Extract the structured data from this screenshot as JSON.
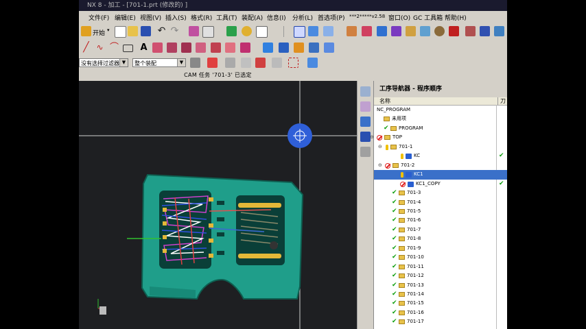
{
  "title_bar": "NX 8 - 加工 - [701-1.prt  (修改的) ]",
  "menu": [
    "文件(F)",
    "编辑(E)",
    "视图(V)",
    "插入(S)",
    "格式(R)",
    "工具(T)",
    "装配(A)",
    "信息(I)",
    "分析(L)",
    "首选项(P)",
    "***2*****v2.58",
    "窗口(O)",
    "GC 工具箱",
    "帮助(H)"
  ],
  "toolbar1": {
    "start_label": "开始"
  },
  "filter_bar": {
    "type_filter": "没有选择过滤器",
    "scope": "整个装配"
  },
  "status_text": "CAM 任务 '701-3' 已选定",
  "navigator": {
    "title": "工序导航器 - 程序顺序",
    "col_name": "名称",
    "col_tool": "刀",
    "rows": [
      {
        "label": "NC_PROGRAM"
      },
      {
        "label": "未用项"
      },
      {
        "label": "PROGRAM"
      },
      {
        "label": "TOP"
      },
      {
        "label": "701-1"
      },
      {
        "label": "KC"
      },
      {
        "label": "701-2"
      },
      {
        "label": "KC1"
      },
      {
        "label": "KC1_COPY"
      },
      {
        "label": "701-3"
      },
      {
        "label": "701-4"
      },
      {
        "label": "701-5"
      },
      {
        "label": "701-6"
      },
      {
        "label": "701-7"
      },
      {
        "label": "701-8"
      },
      {
        "label": "701-9"
      },
      {
        "label": "701-10"
      },
      {
        "label": "701-11"
      },
      {
        "label": "701-12"
      },
      {
        "label": "701-13"
      },
      {
        "label": "701-14"
      },
      {
        "label": "701-15"
      },
      {
        "label": "701-16"
      },
      {
        "label": "701-17"
      }
    ]
  },
  "colors": {
    "part_green": "#1f9e8a",
    "selection": "#3a70c9",
    "viewport": "#1e1f22"
  }
}
